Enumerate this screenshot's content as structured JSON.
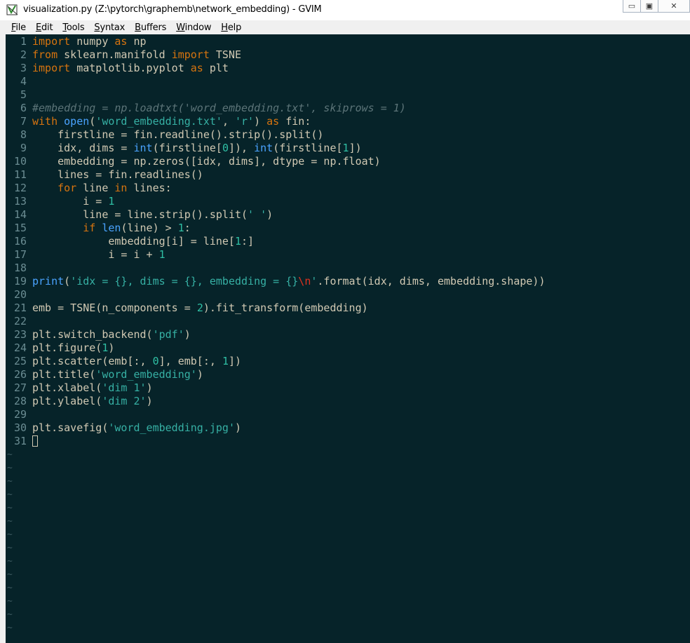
{
  "window": {
    "title": "visualization.py (Z:\\pytorch\\graphemb\\network_embedding) - GVIM",
    "minimize_label": "▭",
    "maximize_label": "▣",
    "close_label": "✕"
  },
  "menu": [
    {
      "label": "File",
      "mnemonic": "F",
      "rest": "ile"
    },
    {
      "label": "Edit",
      "mnemonic": "E",
      "rest": "dit"
    },
    {
      "label": "Tools",
      "mnemonic": "T",
      "rest": "ools"
    },
    {
      "label": "Syntax",
      "mnemonic": "S",
      "rest": "yntax"
    },
    {
      "label": "Buffers",
      "mnemonic": "B",
      "rest": "uffers"
    },
    {
      "label": "Window",
      "mnemonic": "W",
      "rest": "indow"
    },
    {
      "label": "Help",
      "mnemonic": "H",
      "rest": "elp"
    }
  ],
  "code": [
    [
      [
        "k",
        "import"
      ],
      [
        "t",
        " numpy "
      ],
      [
        "k",
        "as"
      ],
      [
        "t",
        " np"
      ]
    ],
    [
      [
        "k",
        "from"
      ],
      [
        "t",
        " sklearn.manifold "
      ],
      [
        "k",
        "import"
      ],
      [
        "t",
        " TSNE"
      ]
    ],
    [
      [
        "k",
        "import"
      ],
      [
        "t",
        " matplotlib.pyplot "
      ],
      [
        "k",
        "as"
      ],
      [
        "t",
        " plt"
      ]
    ],
    [],
    [],
    [
      [
        "c",
        "#embedding = np.loadtxt('word_embedding.txt', skiprows = 1)"
      ]
    ],
    [
      [
        "k",
        "with"
      ],
      [
        "t",
        " "
      ],
      [
        "f",
        "open"
      ],
      [
        "t",
        "("
      ],
      [
        "s",
        "'word_embedding.txt'"
      ],
      [
        "t",
        ", "
      ],
      [
        "s",
        "'r'"
      ],
      [
        "t",
        ") "
      ],
      [
        "k",
        "as"
      ],
      [
        "t",
        " fin:"
      ]
    ],
    [
      [
        "t",
        "    firstline = fin.readline().strip().split()"
      ]
    ],
    [
      [
        "t",
        "    idx, dims = "
      ],
      [
        "f",
        "int"
      ],
      [
        "t",
        "(firstline["
      ],
      [
        "n",
        "0"
      ],
      [
        "t",
        "]), "
      ],
      [
        "f",
        "int"
      ],
      [
        "t",
        "(firstline["
      ],
      [
        "n",
        "1"
      ],
      [
        "t",
        "])"
      ]
    ],
    [
      [
        "t",
        "    embedding = np.zeros([idx, dims], dtype = np.float)"
      ]
    ],
    [
      [
        "t",
        "    lines = fin.readlines()"
      ]
    ],
    [
      [
        "t",
        "    "
      ],
      [
        "k",
        "for"
      ],
      [
        "t",
        " line "
      ],
      [
        "k",
        "in"
      ],
      [
        "t",
        " lines:"
      ]
    ],
    [
      [
        "t",
        "        i = "
      ],
      [
        "n",
        "1"
      ]
    ],
    [
      [
        "t",
        "        line = line.strip().split("
      ],
      [
        "s",
        "' '"
      ],
      [
        "t",
        ")"
      ]
    ],
    [
      [
        "t",
        "        "
      ],
      [
        "k",
        "if"
      ],
      [
        "t",
        " "
      ],
      [
        "f",
        "len"
      ],
      [
        "t",
        "(line) > "
      ],
      [
        "n",
        "1"
      ],
      [
        "t",
        ":"
      ]
    ],
    [
      [
        "t",
        "            embedding[i] = line["
      ],
      [
        "n",
        "1"
      ],
      [
        "t",
        ":]"
      ]
    ],
    [
      [
        "t",
        "            i = i + "
      ],
      [
        "n",
        "1"
      ]
    ],
    [],
    [
      [
        "f",
        "print"
      ],
      [
        "t",
        "("
      ],
      [
        "s",
        "'idx = {}, dims = {}, embedding = {}"
      ],
      [
        "e",
        "\\n"
      ],
      [
        "s",
        "'"
      ],
      [
        "t",
        ".format(idx, dims, embedding.shape))"
      ]
    ],
    [],
    [
      [
        "t",
        "emb = TSNE(n_components = "
      ],
      [
        "n",
        "2"
      ],
      [
        "t",
        ").fit_transform(embedding)"
      ]
    ],
    [],
    [
      [
        "t",
        "plt.switch_backend("
      ],
      [
        "s",
        "'pdf'"
      ],
      [
        "t",
        ")"
      ]
    ],
    [
      [
        "t",
        "plt.figure("
      ],
      [
        "n",
        "1"
      ],
      [
        "t",
        ")"
      ]
    ],
    [
      [
        "t",
        "plt.scatter(emb[:, "
      ],
      [
        "n",
        "0"
      ],
      [
        "t",
        "], emb[:, "
      ],
      [
        "n",
        "1"
      ],
      [
        "t",
        "])"
      ]
    ],
    [
      [
        "t",
        "plt.title("
      ],
      [
        "s",
        "'word_embedding'"
      ],
      [
        "t",
        ")"
      ]
    ],
    [
      [
        "t",
        "plt.xlabel("
      ],
      [
        "s",
        "'dim 1'"
      ],
      [
        "t",
        ")"
      ]
    ],
    [
      [
        "t",
        "plt.ylabel("
      ],
      [
        "s",
        "'dim 2'"
      ],
      [
        "t",
        ")"
      ]
    ],
    [],
    [
      [
        "t",
        "plt.savefig("
      ],
      [
        "s",
        "'word_embedding.jpg'"
      ],
      [
        "t",
        ")"
      ]
    ],
    []
  ],
  "empty_line_marker": "~",
  "empty_line_count": 14
}
